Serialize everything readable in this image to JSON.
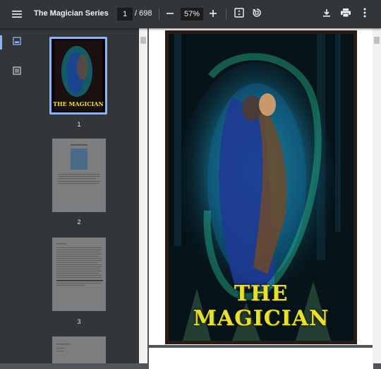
{
  "toolbar": {
    "title": "The Magician Series",
    "page_current": "1",
    "page_total": "/ 698",
    "zoom": "57%",
    "icons": [
      "menu-icon",
      "minus-icon",
      "plus-icon",
      "fit-page-icon",
      "rotate-icon",
      "download-icon",
      "print-icon",
      "more-icon"
    ]
  },
  "sidebar": {
    "tabs": [
      "thumbnails-icon",
      "outline-icon"
    ],
    "thumbnails": [
      {
        "label": "1"
      },
      {
        "label": "2"
      },
      {
        "label": "3"
      }
    ]
  },
  "document": {
    "cover_title": "THE MAGICIAN"
  },
  "colors": {
    "toolbar_bg": "#323639",
    "viewer_bg": "#525659",
    "accent": "#8ab4f8",
    "title_yellow": "#e8e12a"
  }
}
